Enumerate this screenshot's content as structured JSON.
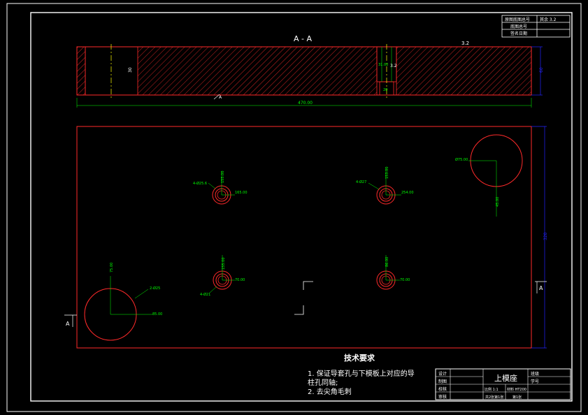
{
  "colors": {
    "background": "#000000",
    "frame": "#ffffff",
    "part": "#ff2a2a",
    "dimension": "#00ff00",
    "centerline": "#ffff00",
    "annotation": "#2424ff"
  },
  "section_view": {
    "title": "A - A",
    "length_dim": "470.00",
    "thickness_dim": "60",
    "hole_label_left": "30",
    "hole_label_mid": "31.00",
    "hole_small": "20",
    "roughness": "3.2",
    "roughness_side": "3.2",
    "leader": "A"
  },
  "plan_view": {
    "height_dim": "320",
    "cut_mark": "A",
    "holes": {
      "top_left": {
        "count_label": "4-Ø25.6",
        "dim_v": "155.00",
        "dim_h": "165.00"
      },
      "top_right": {
        "count_label": "4-Ø27",
        "dim_v": "153.00",
        "dim_h": "254.00"
      },
      "mid_left": {
        "count_label": "4-Ø21",
        "dim_v": "155.00",
        "dim_h": "70.00"
      },
      "mid_right": {
        "dim_v": "86.00",
        "dim_h": "70.00"
      },
      "big_top_right": {
        "dia": "Ø75.00",
        "dim_v": "45.00"
      },
      "big_bottom_left": {
        "dia": "2-Ø25",
        "dim_v": "75.00",
        "dim_h": "85.00"
      }
    }
  },
  "tech_requirements": {
    "title": "技术要求",
    "line1": "1. 保证导套孔与下模板上对应的导",
    "line2": "柱孔同轴;",
    "line3": "2. 去尖角毛刺"
  },
  "title_block": {
    "part_name": "上模座",
    "rows": [
      "设计",
      "制图",
      "校核",
      "审核"
    ],
    "mid1": "比例 1:1",
    "mid2": "材料 HT200",
    "mid3": "共2张第1张",
    "right1": "班级",
    "right2": "学号",
    "sheet": "第1张"
  },
  "corner_table": {
    "r1a": "原图底图总号",
    "r1b": "其余 3.2",
    "r2": "底图总号",
    "r3": "签名日期"
  }
}
